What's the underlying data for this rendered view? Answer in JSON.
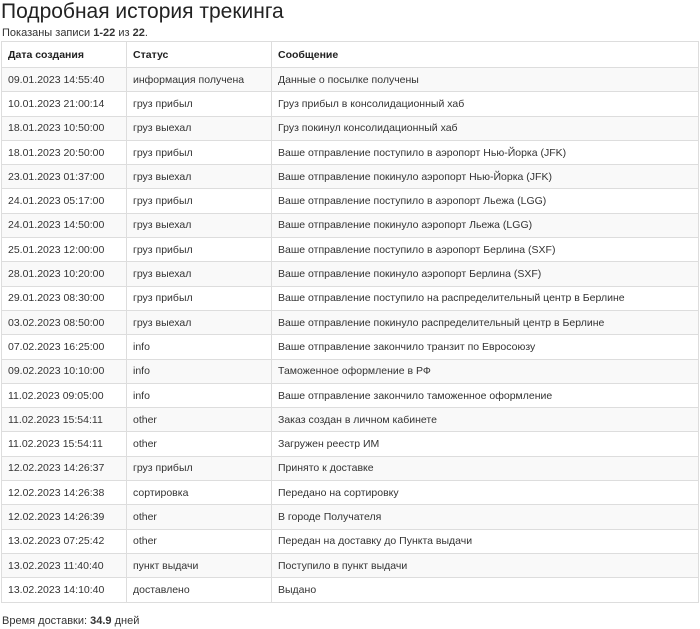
{
  "page_title": "Подробная история трекинга",
  "summary": {
    "prefix": "Показаны записи ",
    "range": "1-22",
    "middle": " из ",
    "total": "22",
    "suffix": "."
  },
  "table": {
    "headers": [
      "Дата создания",
      "Статус",
      "Сообщение"
    ],
    "rows": [
      {
        "date": "09.01.2023 14:55:40",
        "status": "информация получена",
        "message": "Данные о посылке получены"
      },
      {
        "date": "10.01.2023 21:00:14",
        "status": "груз прибыл",
        "message": "Груз прибыл в консолидационный хаб"
      },
      {
        "date": "18.01.2023 10:50:00",
        "status": "груз выехал",
        "message": "Груз покинул консолидационный хаб"
      },
      {
        "date": "18.01.2023 20:50:00",
        "status": "груз прибыл",
        "message": "Ваше отправление поступило в аэропорт Нью-Йорка (JFK)"
      },
      {
        "date": "23.01.2023 01:37:00",
        "status": "груз выехал",
        "message": "Ваше отправление покинуло аэропорт Нью-Йорка (JFK)"
      },
      {
        "date": "24.01.2023 05:17:00",
        "status": "груз прибыл",
        "message": "Ваше отправление поступило в аэропорт Льежа (LGG)"
      },
      {
        "date": "24.01.2023 14:50:00",
        "status": "груз выехал",
        "message": "Ваше отправление покинуло аэропорт Льежа (LGG)"
      },
      {
        "date": "25.01.2023 12:00:00",
        "status": "груз прибыл",
        "message": "Ваше отправление поступило в аэропорт Берлина (SXF)"
      },
      {
        "date": "28.01.2023 10:20:00",
        "status": "груз выехал",
        "message": "Ваше отправление покинуло аэропорт Берлина (SXF)"
      },
      {
        "date": "29.01.2023 08:30:00",
        "status": "груз прибыл",
        "message": "Ваше отправление поступило на распределительный центр в Берлине"
      },
      {
        "date": "03.02.2023 08:50:00",
        "status": "груз выехал",
        "message": "Ваше отправление покинуло распределительный центр в Берлине"
      },
      {
        "date": "07.02.2023 16:25:00",
        "status": "info",
        "message": "Ваше отправление закончило транзит по Евросоюзу"
      },
      {
        "date": "09.02.2023 10:10:00",
        "status": "info",
        "message": "Таможенное оформление в РФ"
      },
      {
        "date": "11.02.2023 09:05:00",
        "status": "info",
        "message": "Ваше отправление закончило таможенное оформление"
      },
      {
        "date": "11.02.2023 15:54:11",
        "status": "other",
        "message": "Заказ создан в личном кабинете"
      },
      {
        "date": "11.02.2023 15:54:11",
        "status": "other",
        "message": "Загружен реестр ИМ"
      },
      {
        "date": "12.02.2023 14:26:37",
        "status": "груз прибыл",
        "message": "Принято к доставке"
      },
      {
        "date": "12.02.2023 14:26:38",
        "status": "сортировка",
        "message": "Передано на сортировку"
      },
      {
        "date": "12.02.2023 14:26:39",
        "status": "other",
        "message": "В городе Получателя"
      },
      {
        "date": "13.02.2023 07:25:42",
        "status": "other",
        "message": "Передан на доставку до Пункта выдачи"
      },
      {
        "date": "13.02.2023 11:40:40",
        "status": "пункт выдачи",
        "message": "Поступило в пункт выдачи"
      },
      {
        "date": "13.02.2023 14:10:40",
        "status": "доставлено",
        "message": "Выдано"
      }
    ]
  },
  "footer": {
    "label": "Время доставки: ",
    "value": "34.9",
    "unit": " дней"
  }
}
